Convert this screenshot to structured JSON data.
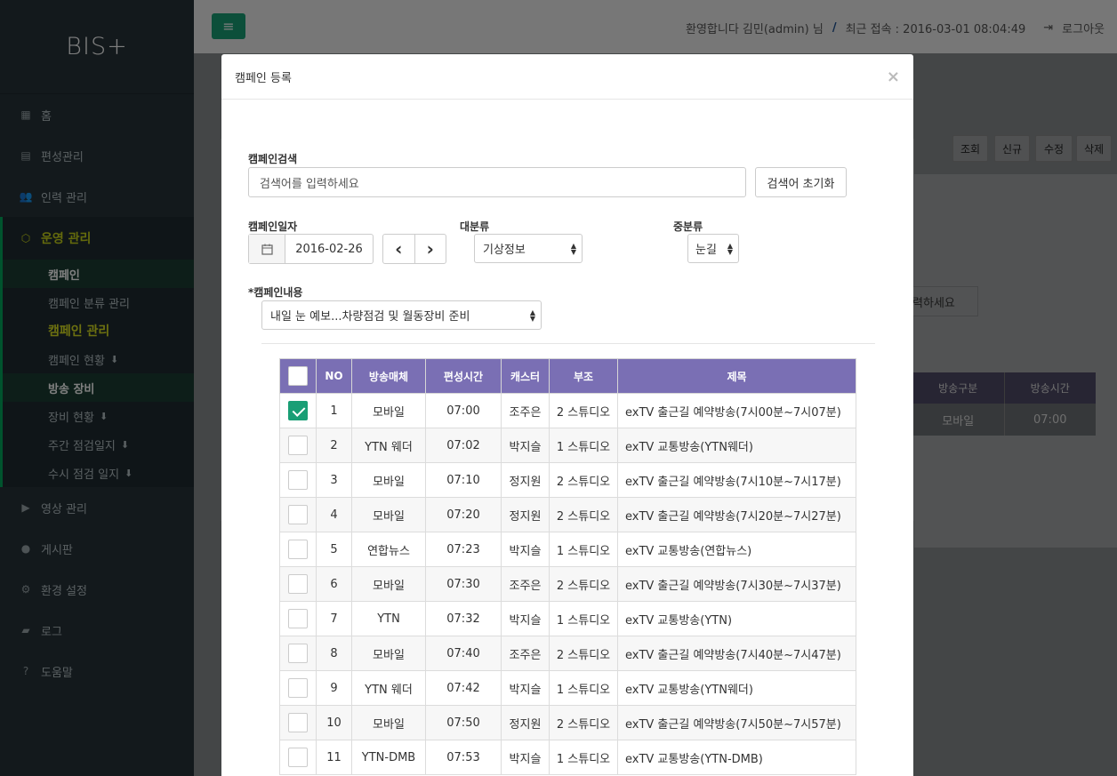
{
  "logo": "BIS+",
  "sidebar": {
    "items": [
      {
        "icon": "grid-icon",
        "glyph": "▦",
        "label": "홈"
      },
      {
        "icon": "calendar-icon",
        "glyph": "▤",
        "label": "편성관리"
      },
      {
        "icon": "users-icon",
        "glyph": "👥",
        "label": "인력 관리"
      }
    ],
    "group": {
      "icon": "cube-icon",
      "glyph": "⬡",
      "label": "운영 관리",
      "subs": [
        {
          "label": "캠페인",
          "style": "hl",
          "download": false
        },
        {
          "label": "캠페인 분류 관리",
          "style": "",
          "download": false
        },
        {
          "label": "캠페인 관리",
          "style": "yel",
          "download": false
        },
        {
          "label": "캠페인 현황",
          "style": "",
          "download": true
        },
        {
          "label": "방송 장비",
          "style": "hl",
          "download": false
        },
        {
          "label": "장비 현황",
          "style": "",
          "download": true
        },
        {
          "label": "주간 점검일지",
          "style": "",
          "download": true
        },
        {
          "label": "수시 점검 일지",
          "style": "",
          "download": true
        }
      ]
    },
    "items2": [
      {
        "icon": "video-icon",
        "glyph": "▶",
        "label": "영상 관리"
      },
      {
        "icon": "comment-icon",
        "glyph": "●",
        "label": "게시판"
      },
      {
        "icon": "cogs-icon",
        "glyph": "⚙",
        "label": "환경 설정"
      },
      {
        "icon": "book-icon",
        "glyph": "▰",
        "label": "로그"
      },
      {
        "icon": "question-icon",
        "glyph": "?",
        "label": "도움말"
      }
    ]
  },
  "topbar": {
    "menu_glyph": "≡",
    "welcome": "환영합니다 김민(admin) 님",
    "sep": "/",
    "last_login": "최근 접속 : 2016-03-01 08:04:49",
    "logout_glyph": "⇥",
    "logout": "로그아웃"
  },
  "background": {
    "buttons": [
      "조회",
      "신규",
      "수정",
      "삭제"
    ],
    "search_hint": "입력하세요",
    "col_type": "방송구분",
    "col_time": "방송시간",
    "cell_type": "모바일",
    "cell_time": "07:00"
  },
  "modal": {
    "title": "캠페인 등록",
    "close": "×",
    "search_label": "캠페인검색",
    "search_placeholder": "검색어를 입력하세요",
    "reset_button": "검색어 초기화",
    "date_label": "캠페인일자",
    "date_value": "2016-02-26",
    "prev": "‹",
    "next": "›",
    "major_label": "대분류",
    "major_value": "기상정보",
    "minor_label": "중분류",
    "minor_value": "눈길",
    "content_label": "*캠페인내용",
    "content_value": "내일 눈 예보...차량점검 및 월동장비 준비"
  },
  "table": {
    "headers": [
      "NO",
      "방송매체",
      "편성시간",
      "캐스터",
      "부조",
      "제목"
    ],
    "rows": [
      {
        "checked": true,
        "no": "1",
        "media": "모바일",
        "time": "07:00",
        "caster": "조주은",
        "studio": "2 스튜디오",
        "title": "exTV 출근길 예약방송(7시00분~7시07분)"
      },
      {
        "checked": false,
        "no": "2",
        "media": "YTN 웨더",
        "time": "07:02",
        "caster": "박지슬",
        "studio": "1 스튜디오",
        "title": "exTV 교통방송(YTN웨더)"
      },
      {
        "checked": false,
        "no": "3",
        "media": "모바일",
        "time": "07:10",
        "caster": "정지원",
        "studio": "2 스튜디오",
        "title": "exTV 출근길 예약방송(7시10분~7시17분)"
      },
      {
        "checked": false,
        "no": "4",
        "media": "모바일",
        "time": "07:20",
        "caster": "정지원",
        "studio": "2 스튜디오",
        "title": "exTV 출근길 예약방송(7시20분~7시27분)"
      },
      {
        "checked": false,
        "no": "5",
        "media": "연합뉴스",
        "time": "07:23",
        "caster": "박지슬",
        "studio": "1 스튜디오",
        "title": "exTV 교통방송(연합뉴스)"
      },
      {
        "checked": false,
        "no": "6",
        "media": "모바일",
        "time": "07:30",
        "caster": "조주은",
        "studio": "2 스튜디오",
        "title": "exTV 출근길 예약방송(7시30분~7시37분)"
      },
      {
        "checked": false,
        "no": "7",
        "media": "YTN",
        "time": "07:32",
        "caster": "박지슬",
        "studio": "1 스튜디오",
        "title": "exTV 교통방송(YTN)"
      },
      {
        "checked": false,
        "no": "8",
        "media": "모바일",
        "time": "07:40",
        "caster": "조주은",
        "studio": "2 스튜디오",
        "title": "exTV 출근길 예약방송(7시40분~7시47분)"
      },
      {
        "checked": false,
        "no": "9",
        "media": "YTN 웨더",
        "time": "07:42",
        "caster": "박지슬",
        "studio": "1 스튜디오",
        "title": "exTV 교통방송(YTN웨더)"
      },
      {
        "checked": false,
        "no": "10",
        "media": "모바일",
        "time": "07:50",
        "caster": "정지원",
        "studio": "2 스튜디오",
        "title": "exTV 출근길 예약방송(7시50분~7시57분)"
      },
      {
        "checked": false,
        "no": "11",
        "media": "YTN-DMB",
        "time": "07:53",
        "caster": "박지슬",
        "studio": "1 스튜디오",
        "title": "exTV 교통방송(YTN-DMB)"
      }
    ]
  }
}
